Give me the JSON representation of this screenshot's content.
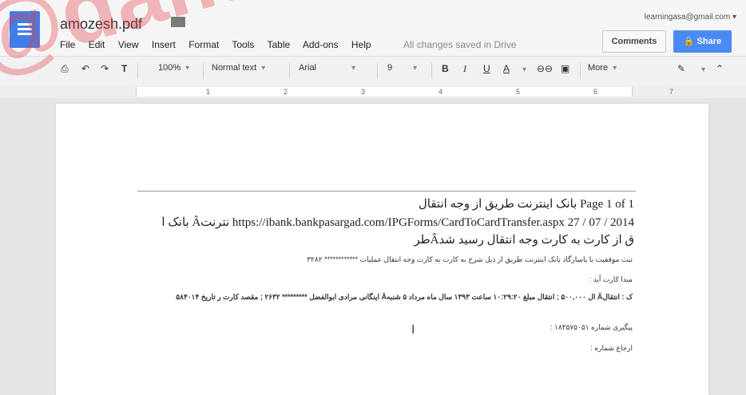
{
  "header": {
    "title": "amozesh.pdf",
    "email": "learningasa@gmail.com ▾",
    "comments_label": "Comments",
    "share_label": "Share",
    "saved_status": "All changes saved in Drive"
  },
  "menu": [
    "File",
    "Edit",
    "View",
    "Insert",
    "Format",
    "Tools",
    "Table",
    "Add-ons",
    "Help"
  ],
  "toolbar": {
    "zoom": "100%",
    "style": "Normal text",
    "font": "Arial",
    "size": "9",
    "more_label": "More"
  },
  "ruler": [
    "1",
    "2",
    "3",
    "4",
    "5",
    "6",
    "7"
  ],
  "document": {
    "line1": "Page 1 of 1 بانک اینترنت طریق از وجه انتقال",
    "line2": "https://ibank.bankpasargad.com/IPGForms/CardToCardTransfer.aspx 27 / 07 / 2014 نترنتÂ بانک ا",
    "line3": "ق از کارت به کارت وجه انتقال رسید شدÂطر",
    "line4": "ثبت موفقیت با پاسارگاد بانک اینترنت طریق از ذیل شرح به کارت به کارت وجه انتقال عملیات ************ ۳۲۸۲",
    "line5": "مبدا کارت آید :",
    "line6": "ک : انتقالÂ ال ۵۰۰,۰۰۰ ; انتقال مبلغ ۱۰:۲۹:۲۰ ساعت ۱۳۹۳ سال ماه مرداد ۵ شنبهÂ اینگانی مرادی ابوالفضل ********* ۲۶۳۲ ; مقصد کارت ر تاریخ ۵۸۴۰۱۴",
    "line7": "پیگیری شماره ۱۸۴۵۷۵۰۵۱ :",
    "line8": "ارجاع شماره :"
  },
  "watermark": "@dam"
}
